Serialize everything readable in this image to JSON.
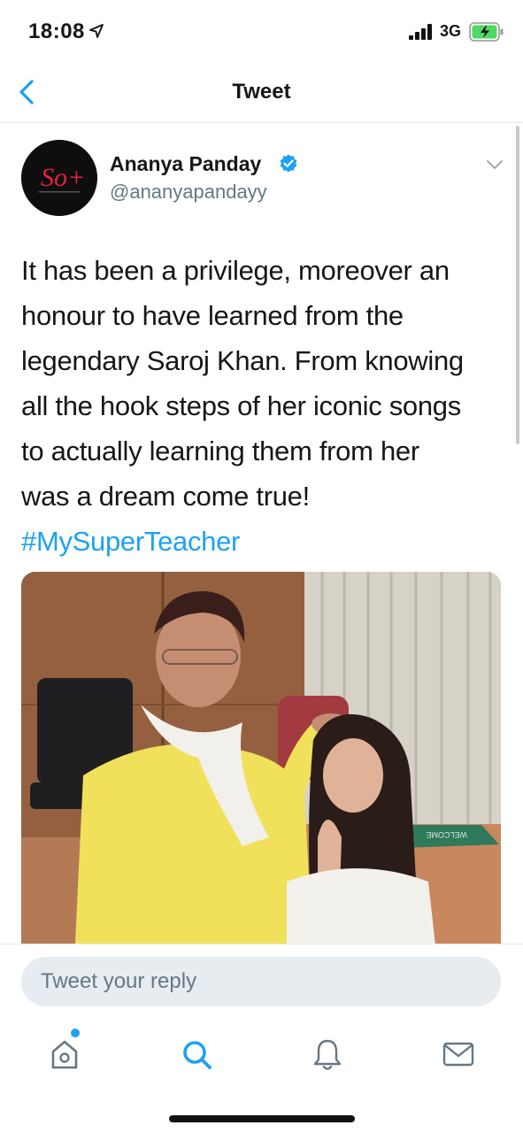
{
  "status_bar": {
    "time": "18:08",
    "network": "3G"
  },
  "nav": {
    "title": "Tweet"
  },
  "tweet": {
    "author_name": "Ananya Panday",
    "author_handle": "@ananyapandayy",
    "text_lines": [
      "It has been a privilege, moreover an",
      "honour to have learned from the",
      "legendary Saroj Khan. From knowing",
      "all the hook steps of her iconic songs",
      "to actually learning them from her",
      "was a dream come true!"
    ],
    "hashtag": "#MySuperTeacher",
    "avatar_logo": "So+",
    "media_wall_sign": "WELCOME"
  },
  "reply": {
    "placeholder": "Tweet your reply"
  },
  "tabs": [
    {
      "name": "home-icon"
    },
    {
      "name": "search-icon"
    },
    {
      "name": "bell-icon"
    },
    {
      "name": "mail-icon"
    }
  ],
  "colors": {
    "accent": "#1da1f2",
    "text": "#14171a",
    "secondary_text": "#657786",
    "input_bg": "#e6ecf0",
    "battery_fill": "#4cd964"
  }
}
